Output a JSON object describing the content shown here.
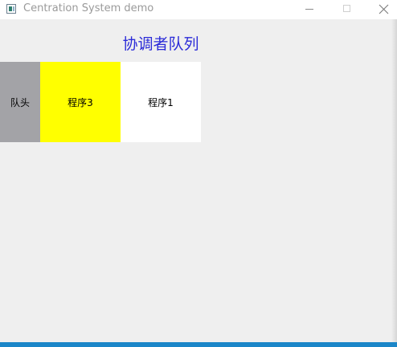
{
  "window": {
    "title": "Centration System demo",
    "icon": "app-window-icon",
    "controls": {
      "minimize": "minimize-icon",
      "maximize": "maximize-icon",
      "close": "close-icon"
    }
  },
  "queue": {
    "title": "协调者队列",
    "title_color": "#2b2bd8",
    "items": [
      {
        "label": "队头",
        "color": "#a3a3a7"
      },
      {
        "label": "程序3",
        "color": "#ffff00"
      },
      {
        "label": "程序1",
        "color": "#ffffff"
      }
    ]
  },
  "colors": {
    "background": "#efefef",
    "taskbar_accent": "#1b86c8"
  }
}
